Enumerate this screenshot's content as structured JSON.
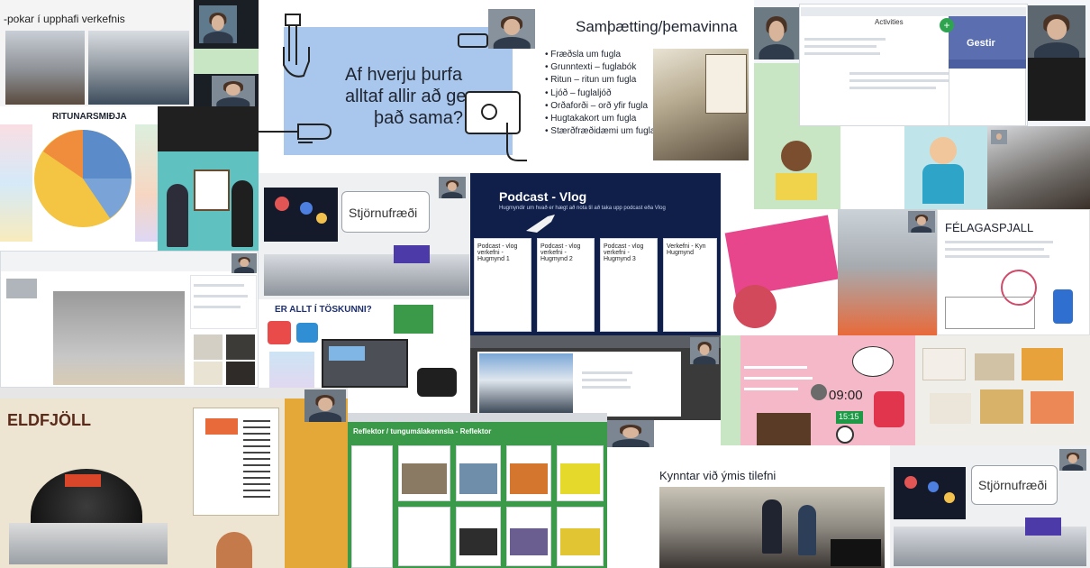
{
  "tiles": {
    "pokar": {
      "caption": "-pokar í upphafi verkefnis"
    },
    "ritun": {
      "title": "RITUNARSMIÐJA"
    },
    "af_hverju": {
      "line1": "Af hverju þurfa",
      "line2": "alltaf allir að gera",
      "line3": "það sama?"
    },
    "sambaetting": {
      "title": "Samþætting/þemavinna",
      "items": [
        "Fræðsla um fugla",
        "Grunntexti – fuglabók",
        "Ritun – ritun um fugla",
        "Ljóð – fuglaljóð",
        "Orðaforði – orð yfir fugla",
        "Hugtakakort um fugla",
        "Stærðfræðidæmi um fugla"
      ]
    },
    "gestir": {
      "label": "Gestir",
      "activities": "Activities"
    },
    "stjornufraedi_1": {
      "label": "Stjörnufræði"
    },
    "podcast": {
      "title": "Podcast - Vlog",
      "subtitle": "Hugmyndir um hvað er hægt að nota til að taka upp podcast eða Vlog",
      "cards": [
        "Podcast - vlog verkefni - Hugmynd 1",
        "Podcast - vlog verkefni - Hugmynd 2",
        "Podcast - vlog verkefni - Hugmynd 3",
        "Verkefni - Kyn Hugmynd"
      ]
    },
    "toskunni": {
      "title": "ER ALLT Í TÖSKUNNI?"
    },
    "felagasnall": {
      "title": "FÉLAGASPJALL"
    },
    "timer": {
      "time": "09:00",
      "small_time": "15:15"
    },
    "eldfjoll": {
      "title": "ELDFJÖLL"
    },
    "padlet": {
      "title": "Reflektor / tungumálakennsla - Reflektor"
    },
    "kynntar": {
      "caption": "Kynntar við ýmis tilefni"
    },
    "stjornufraedi_2": {
      "label": "Stjörnufræði"
    }
  },
  "colors": {
    "slide_blue": "#a9c7ec",
    "ritun_yellow": "#f4c542",
    "ritun_blue": "#5b8bc9",
    "green_panel": "#c9e6c4",
    "podcast_navy": "#0f1f4a",
    "pink_slide": "#f4b8c9",
    "padlet_green": "#3b9a4a"
  }
}
